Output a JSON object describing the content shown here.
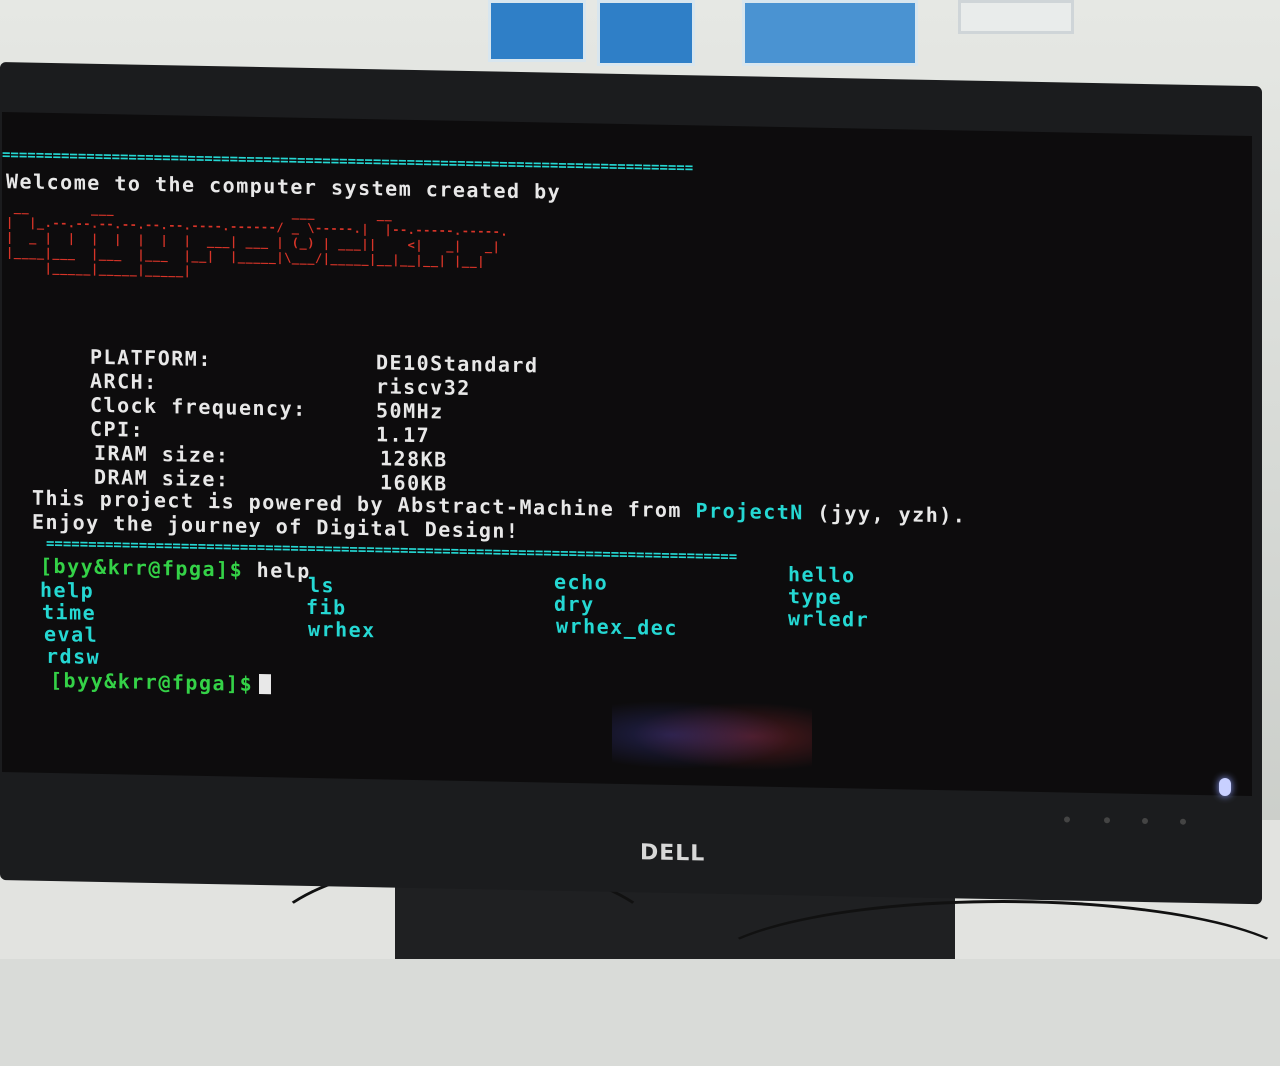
{
  "separator_top": "==================================================================================",
  "welcome": "Welcome to the computer system created by",
  "ascii_art": " __        ___                       ___        __\n|  |_.--.--.--.--.--.--.----.------/ _ \\-----.|  |--.-----.-----.\n|  _ |  |  |  |  |  |  |  ___| ___ | (_) | ___||    <|   _|   _|\n|____|___  |___  |___  |__|  |_____|\\___/|_____|__|__|__| |__|\n     |_____|_____|_____|",
  "info": [
    {
      "label": "PLATFORM:",
      "value": "DE10Standard"
    },
    {
      "label": "ARCH:",
      "value": "riscv32"
    },
    {
      "label": "Clock frequency:",
      "value": "50MHz"
    },
    {
      "label": "CPI:",
      "value": "1.17"
    },
    {
      "label": "IRAM size:",
      "value": "128KB"
    },
    {
      "label": "DRAM size:",
      "value": "160KB"
    }
  ],
  "powered_prefix": "This project is powered by Abstract-Machine from ",
  "powered_link": "ProjectN",
  "powered_suffix": " (jyy, yzh).",
  "enjoy": "Enjoy the journey of Digital Design!",
  "separator_bottom": "==================================================================================",
  "prompt": "[byy&krr@fpga]$",
  "command": "help",
  "commands": {
    "col1": [
      "help",
      "time",
      "eval",
      "rdsw"
    ],
    "col2": [
      "ls",
      "fib",
      "wrhex"
    ],
    "col3": [
      "echo",
      "dry",
      "wrhex_dec"
    ],
    "col4": [
      "hello",
      "type",
      "wrledr"
    ]
  },
  "prompt2": "[byy&krr@fpga]$",
  "brand": "DELL"
}
